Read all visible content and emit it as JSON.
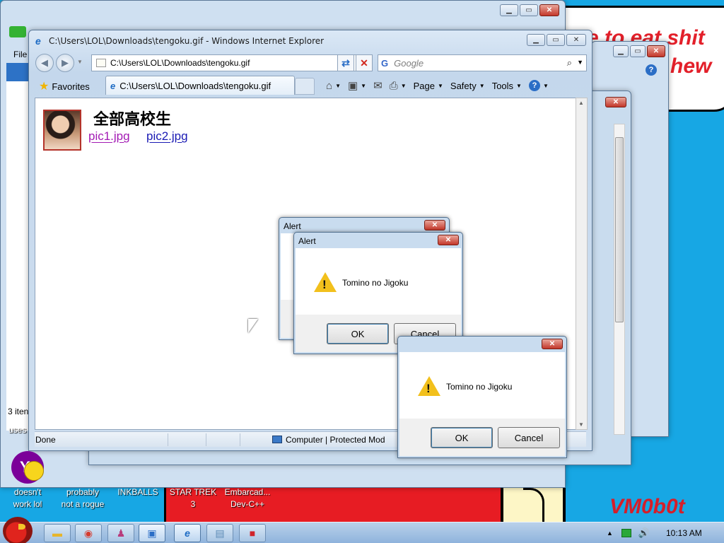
{
  "wallpaper": {
    "speech_text_1": "e to eat shit",
    "speech_text_2": "hew",
    "signature": "VM0b0t"
  },
  "ie": {
    "window_title": "C:\\Users\\LOL\\Downloads\\tengoku.gif - Windows Internet Explorer",
    "address": "C:\\Users\\LOL\\Downloads\\tengoku.gif",
    "search_placeholder": "Google",
    "favorites_label": "Favorites",
    "tab_label": "C:\\Users\\LOL\\Downloads\\tengoku.gif",
    "toolbar": {
      "page": "Page",
      "safety": "Safety",
      "tools": "Tools"
    },
    "content": {
      "heading": "全部高校生",
      "link1": "pic1.jpg",
      "link2": "pic2.jpg"
    },
    "status": {
      "left": "Done",
      "zone": "Computer | Protected Mod"
    }
  },
  "back_window": {
    "menu_file": "File",
    "status_items": "3 iten"
  },
  "dialogs": [
    {
      "title": "Alert",
      "message": "",
      "ok": "",
      "cancel": ""
    },
    {
      "title": "Alert",
      "message": "Tomino no Jigoku",
      "ok": "OK",
      "cancel": "Cancel"
    },
    {
      "title": "",
      "message": "Tomino no Jigoku",
      "ok": "OK",
      "cancel": "Cancel"
    }
  ],
  "desktop_icons": [
    {
      "label": "uses"
    },
    {
      "label": "doesn't\nwork lol"
    },
    {
      "label": "probably\nnot a rogue"
    },
    {
      "label": "INKBALLS"
    },
    {
      "label": "STAR TREK\n3"
    },
    {
      "label": "Embarcad...\nDev-C++"
    }
  ],
  "taskbar": {
    "clock": "10:13 AM"
  }
}
